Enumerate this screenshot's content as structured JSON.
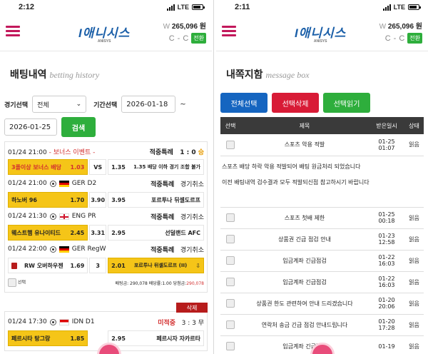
{
  "left": {
    "status": {
      "time": "2:12",
      "network": "LTE"
    },
    "wallet": {
      "prefix": "W",
      "balance": "265,096 원",
      "c1": "C",
      "sep": "-",
      "c2": "C",
      "convert": "전환"
    },
    "logo": {
      "text": "I애니시스",
      "sub": "ANISYS"
    },
    "title": {
      "ko": "배팅내역",
      "en": "betting history"
    },
    "filters": {
      "game_label": "경기선택",
      "game_value": "전체",
      "period_label": "기간선택",
      "start": "2026-01-18",
      "tilde": "~",
      "end": "2026-01-25",
      "search": "검색"
    },
    "card1": {
      "time1": "01/24 21:00",
      "bonus": "- 보너스 이벤트 -",
      "type1": "적중특례",
      "score1": "1 : 0",
      "res1": "승",
      "b_home": "3폴이상 보너스 배당",
      "b_home_odds": "1.03",
      "b_vs": "VS",
      "b_away_odds": "1.35",
      "b_away": "1.35 배당 이하 경기 조합 불가",
      "time2": "01/24 21:00",
      "league2": "GER D2",
      "type2": "적중특례",
      "state2": "경기취소",
      "m2_home": "하노버 96",
      "m2_home_odds": "1.70",
      "m2_draw": "3.90",
      "m2_away_odds": "3.95",
      "m2_away": "포르투나 뒤셀도르프",
      "time3": "01/24 21:30",
      "league3": "ENG PR",
      "type3": "적중특례",
      "state3": "경기취소",
      "m3_home": "웨스트햄 유나이티드",
      "m3_home_odds": "2.45",
      "m3_draw": "3.31",
      "m3_away_odds": "2.95",
      "m3_away": "선덜랜드 AFC",
      "time4": "01/24 22:00",
      "league4": "GER RegW",
      "type4": "적중특례",
      "state4": "경기취소",
      "m4_home": "RW 오버하우젠",
      "m4_home_odds": "1.69",
      "m4_draw": "3",
      "m4_away_odds": "2.01",
      "m4_away": "포르투나 뒤셀도르프 (II)",
      "select": "선택",
      "summary_a": "배팅금: 290,078 배당률:1.00 당첨금:",
      "summary_b": "290,078",
      "delete": "삭제"
    },
    "card2": {
      "time": "01/24 17:30",
      "league": "IDN D1",
      "status": "미적중",
      "score": "3 : 3",
      "res": "무",
      "home": "페르시타 탕그랑",
      "home_odds": "1.85",
      "away_odds": "2.95",
      "away": "페르시자 자카르타"
    }
  },
  "right": {
    "status": {
      "time": "2:11",
      "network": "LTE"
    },
    "wallet": {
      "prefix": "W",
      "balance": "265,096 원",
      "c1": "C",
      "sep": "-",
      "c2": "C",
      "convert": "전환"
    },
    "logo": {
      "text": "I애니시스",
      "sub": "ANISYS"
    },
    "title": {
      "ko": "내쪽지함",
      "en": "message box"
    },
    "buttons": {
      "select_all": "전체선택",
      "delete_selected": "선택삭제",
      "read_selected": "선택읽기"
    },
    "table": {
      "headers": [
        "선택",
        "제목",
        "받은일시",
        "상태"
      ],
      "rows": [
        {
          "title": "스포츠 악용 적발",
          "date": "01-25",
          "time": "01:07",
          "state": "읽음"
        },
        {
          "title": "스포츠 첫배 제한",
          "date": "01-25",
          "time": "00:18",
          "state": "읽음"
        },
        {
          "title": "상품권 긴급 점검 안내",
          "date": "01-23",
          "time": "12:58",
          "state": "읽음"
        },
        {
          "title": "입금계좌 긴급점검",
          "date": "01-22",
          "time": "16:03",
          "state": "읽음"
        },
        {
          "title": "입금계좌 긴급점검",
          "date": "01-22",
          "time": "16:03",
          "state": "읽음"
        },
        {
          "title": "상품권 한도 관련하여 안내 드리겠습니다",
          "date": "01-20",
          "time": "20:06",
          "state": "읽음"
        },
        {
          "title": "연락처 송금 긴급 점검 안내드립니다",
          "date": "01-20",
          "time": "17:28",
          "state": "읽음"
        },
        {
          "title": "입금계좌 긴급점검",
          "date": "01-19",
          "time": "",
          "state": "읽음"
        }
      ],
      "expanded": {
        "line1": "스포츠 배당 하락 악용 적발되어 배팅 원금처리 되었습니다",
        "line2": "이전 배팅내역 검수결과 모두 적발되신점 참고하시기 바랍니다"
      }
    }
  }
}
